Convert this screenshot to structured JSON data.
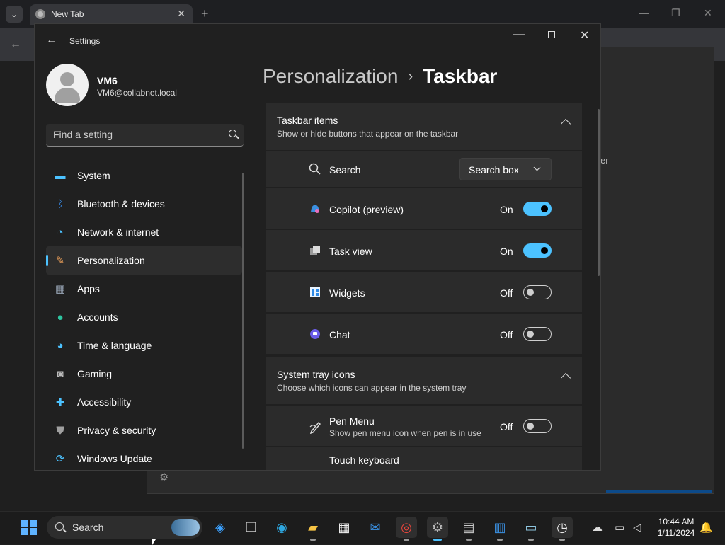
{
  "chrome": {
    "tab_title": "New Tab",
    "tab_close": "✕",
    "new_tab": "+",
    "dropdown": "⌄",
    "min": "—",
    "max": "❐",
    "close": "✕",
    "back": "←",
    "partial_text": "er"
  },
  "settings": {
    "app_title": "Settings",
    "back": "←",
    "min": "—",
    "close": "✕",
    "user": {
      "name": "VM6",
      "email": "VM6@collabnet.local"
    },
    "search": {
      "placeholder": "Find a setting"
    },
    "nav": [
      {
        "label": "System",
        "icon": "system-icon",
        "glyph": "▬",
        "color": "#4cc2ff"
      },
      {
        "label": "Bluetooth & devices",
        "icon": "bluetooth-icon",
        "glyph": "ᛒ",
        "color": "#3a96ff"
      },
      {
        "label": "Network & internet",
        "icon": "network-icon",
        "glyph": "◔",
        "color": "#4cc2ff"
      },
      {
        "label": "Personalization",
        "icon": "brush-icon",
        "glyph": "✎",
        "color": "#f0a25a"
      },
      {
        "label": "Apps",
        "icon": "apps-icon",
        "glyph": "▦",
        "color": "#9aa7b8"
      },
      {
        "label": "Accounts",
        "icon": "accounts-icon",
        "glyph": "●",
        "color": "#2ec4a0"
      },
      {
        "label": "Time & language",
        "icon": "globe-icon",
        "glyph": "◕",
        "color": "#4cc2ff"
      },
      {
        "label": "Gaming",
        "icon": "gamepad-icon",
        "glyph": "◙",
        "color": "#bbbbbb"
      },
      {
        "label": "Accessibility",
        "icon": "accessibility-icon",
        "glyph": "✚",
        "color": "#4cc2ff"
      },
      {
        "label": "Privacy & security",
        "icon": "shield-icon",
        "glyph": "⛊",
        "color": "#a0a0a0"
      },
      {
        "label": "Windows Update",
        "icon": "update-icon",
        "glyph": "⟳",
        "color": "#4cc2ff"
      }
    ],
    "active_nav_index": 3,
    "breadcrumb": {
      "parent": "Personalization",
      "separator": "›",
      "current": "Taskbar"
    },
    "taskbar_items": {
      "title": "Taskbar items",
      "subtitle": "Show or hide buttons that appear on the taskbar",
      "search": {
        "label": "Search",
        "value": "Search box"
      },
      "rows": [
        {
          "label": "Copilot (preview)",
          "state": "On",
          "on": true,
          "icon": "copilot-icon"
        },
        {
          "label": "Task view",
          "state": "On",
          "on": true,
          "icon": "task-view-icon"
        },
        {
          "label": "Widgets",
          "state": "Off",
          "on": false,
          "icon": "widgets-icon"
        },
        {
          "label": "Chat",
          "state": "Off",
          "on": false,
          "icon": "chat-icon"
        }
      ]
    },
    "system_tray": {
      "title": "System tray icons",
      "subtitle": "Choose which icons can appear in the system tray",
      "pen_menu": {
        "label": "Pen Menu",
        "sub": "Show pen menu icon when pen is in use",
        "state": "Off",
        "on": false
      },
      "touch_keyboard": {
        "label": "Touch keyboard"
      }
    }
  },
  "taskbar": {
    "search_label": "Search",
    "time": "10:44 AM",
    "date": "1/11/2024",
    "apps": [
      {
        "name": "copilot-app-icon",
        "glyph": "◈",
        "color": "#3aa0ff"
      },
      {
        "name": "task-view-app-icon",
        "glyph": "❐",
        "color": "#cccccc"
      },
      {
        "name": "edge-icon",
        "glyph": "◉",
        "color": "#2ea7e0"
      },
      {
        "name": "file-explorer-icon",
        "glyph": "▰",
        "color": "#f6c344"
      },
      {
        "name": "store-icon",
        "glyph": "▦",
        "color": "#f2f2f2"
      },
      {
        "name": "mail-icon",
        "glyph": "✉",
        "color": "#3a8fe0"
      },
      {
        "name": "chrome-icon",
        "glyph": "◎",
        "color": "#e8453c"
      },
      {
        "name": "settings-app-icon",
        "glyph": "⚙",
        "color": "#bbbbbb"
      },
      {
        "name": "calculator-icon",
        "glyph": "▤",
        "color": "#cccccc"
      },
      {
        "name": "calendar-icon",
        "glyph": "▥",
        "color": "#3a8fe0"
      },
      {
        "name": "remote-desktop-icon",
        "glyph": "▭",
        "color": "#8ec6e0"
      },
      {
        "name": "clock-app-icon",
        "glyph": "◷",
        "color": "#eeeeee"
      }
    ]
  }
}
